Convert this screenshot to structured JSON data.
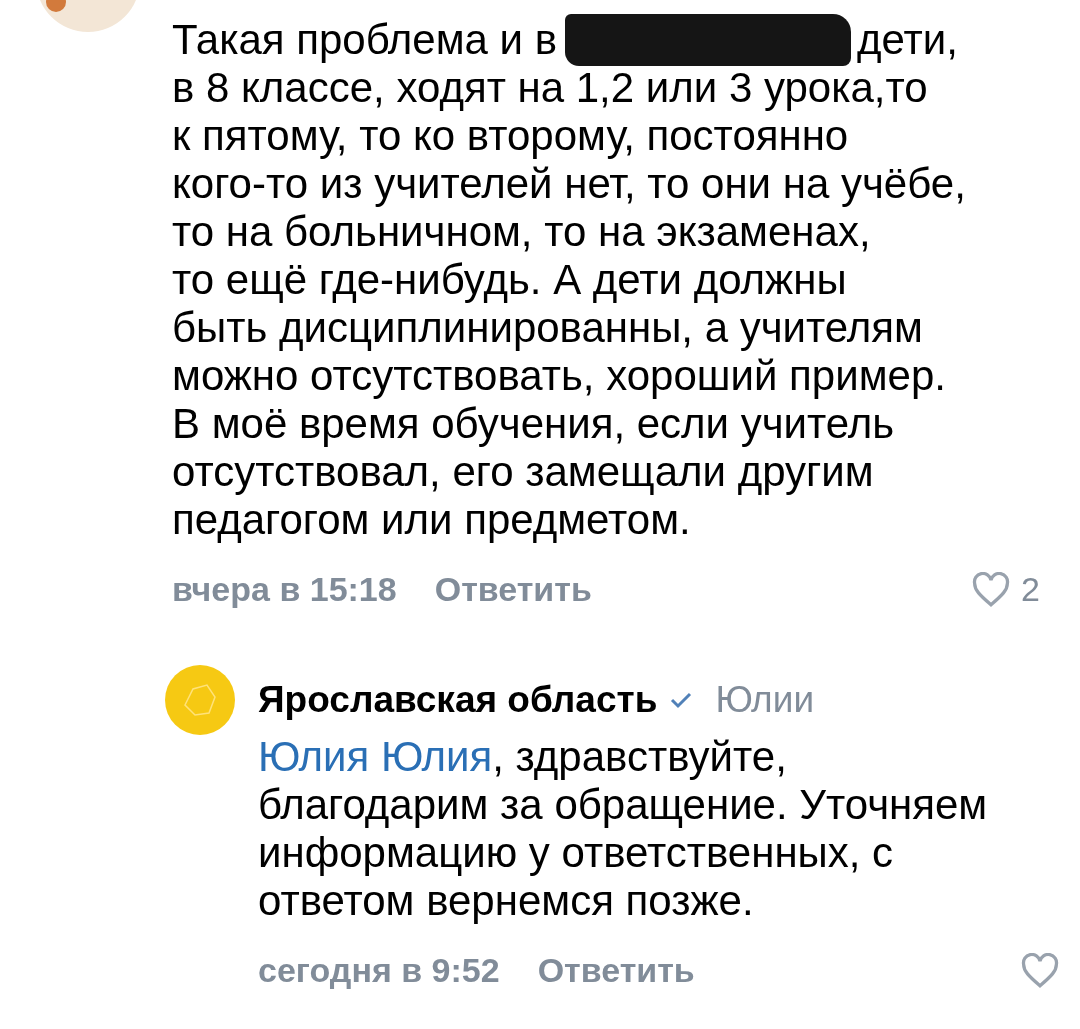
{
  "comments": [
    {
      "kind": "comment",
      "text_before_redaction": "Такая проблема и в",
      "redacted": true,
      "text": "дети,\nв 8 классе, ходят на 1,2 или 3 урока,то\nк пятому, то ко второму, постоянно\nкого-то из учителей нет, то они на учёбе,\nто на больничном, то на экзаменах,\nто ещё где-нибудь. А дети должны\nбыть дисциплинированны, а учителям\nможно отсутствовать, хороший пример.\nВ моё время обучения, если учитель\nотсутствовал, его замещали другим\nпедагогом или предметом.",
      "time": "вчера в 15:18",
      "reply_label": "Ответить",
      "liked": false,
      "likes": "2"
    },
    {
      "kind": "reply",
      "author": "Ярославская область",
      "verified": true,
      "reply_to": "Юлии",
      "mention": "Юлия Юлия",
      "text": ", здравствуйте,\nблагодарим за обращение. Уточняем\nинформацию у ответственных, с\nответом вернемся позже.",
      "time": "сегодня в 9:52",
      "reply_label": "Ответить",
      "liked": false
    }
  ]
}
